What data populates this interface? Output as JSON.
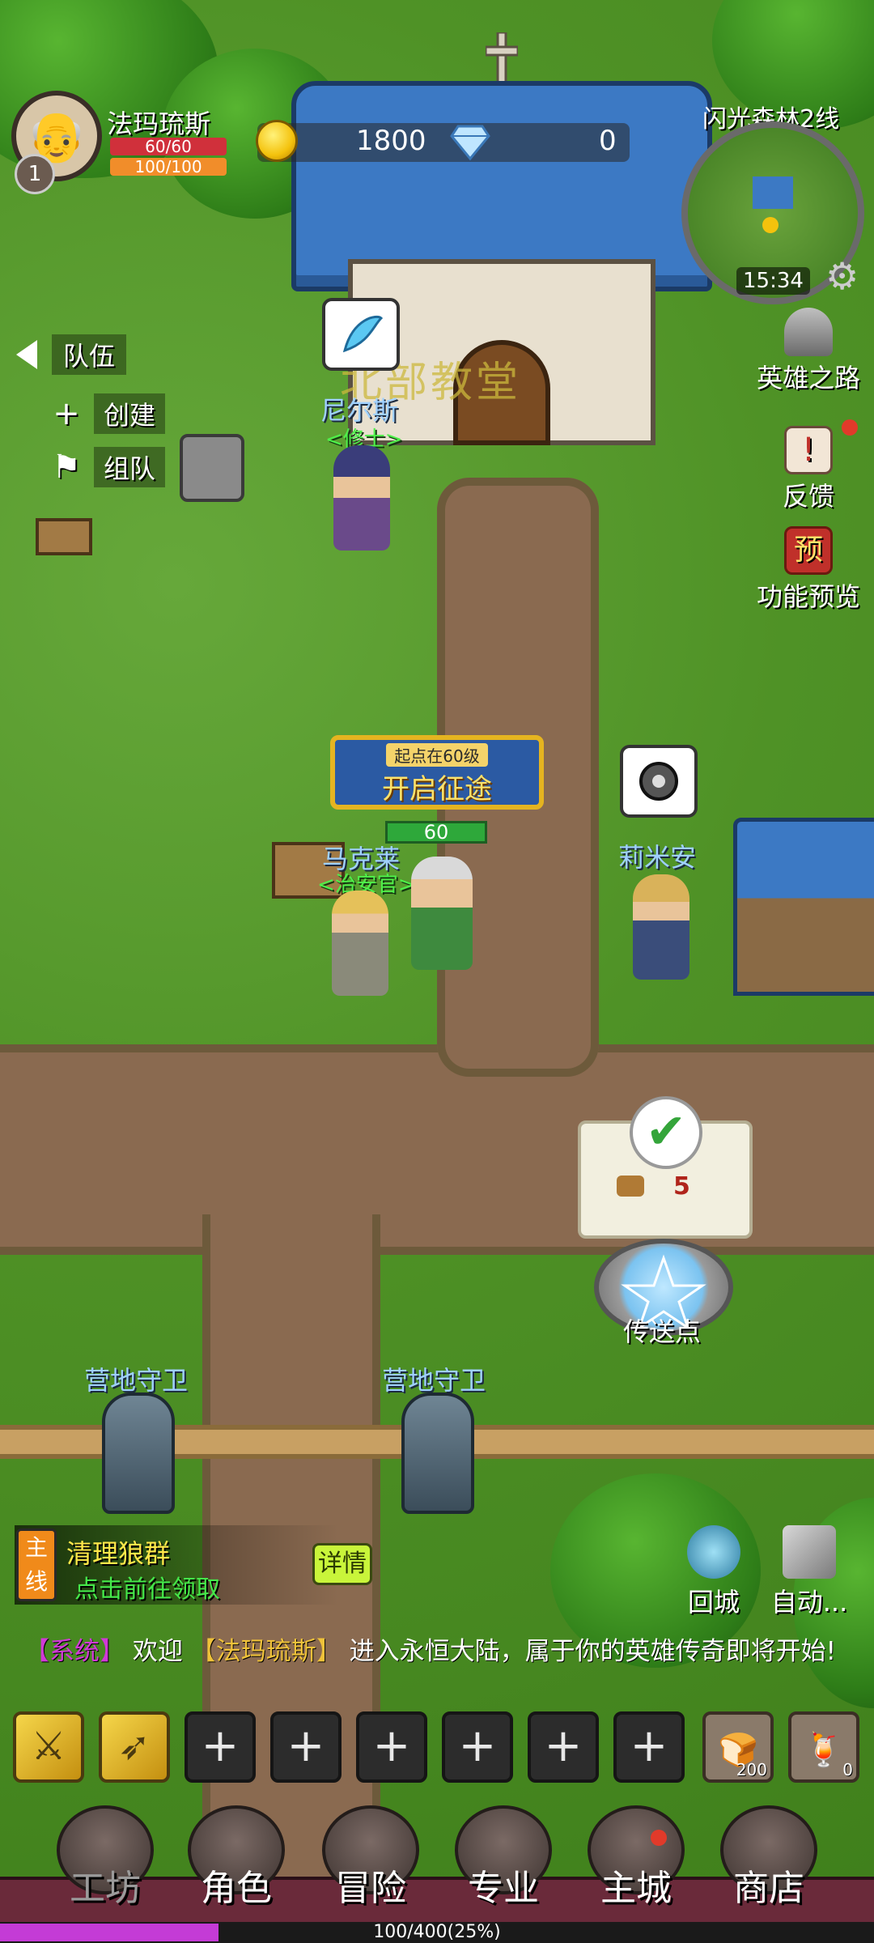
{
  "player": {
    "name": "法玛琉斯",
    "level": "1",
    "hp": "60/60",
    "mp": "100/100"
  },
  "currency": {
    "gold": "1800",
    "gems": "0"
  },
  "map": {
    "name": "闪光森林2线",
    "time": "15:34"
  },
  "team": {
    "title": "队伍",
    "create": "创建",
    "join": "组队"
  },
  "right_menu": {
    "hero_road": "英雄之路",
    "feedback": "反馈",
    "preview": "功能预览",
    "preview_badge": "预"
  },
  "church_label": "北部教堂",
  "npcs": {
    "nierse": {
      "name": "尼尔斯",
      "title": "<修士>"
    },
    "makelai": {
      "name": "马克莱",
      "title": "<治安官>"
    },
    "limian": {
      "name": "莉米安"
    },
    "guard_left": {
      "name": "营地守卫"
    },
    "guard_right": {
      "name": "营地守卫"
    }
  },
  "banner": {
    "sub": "起点在60级",
    "main": "开启征途"
  },
  "player_level_bar": "60",
  "reward": {
    "count": "5"
  },
  "portal": {
    "label": "传送点"
  },
  "quest": {
    "tag": "主线",
    "title": "清理狼群",
    "sub": "点击前往领取",
    "detail": "详情"
  },
  "actions": {
    "return": "回城",
    "auto": "自动..."
  },
  "chat": {
    "tag": "【系统】",
    "prefix": "欢迎",
    "name": "【法玛琉斯】",
    "text": "进入永恒大陆，属于你的英雄传奇即将开始!"
  },
  "slots": {
    "plus": "+",
    "item1_count": "200",
    "item2_count": "0"
  },
  "nav": [
    "工坊",
    "角色",
    "冒险",
    "专业",
    "主城",
    "商店"
  ],
  "xp": {
    "text": "100/400(25%)",
    "fraction": 0.25
  },
  "colors": {
    "accent": "#f4c20d",
    "hp": "#d0303b",
    "mp": "#f18d2a",
    "xp": "#c43bd6",
    "quest_green": "#45e84a"
  }
}
